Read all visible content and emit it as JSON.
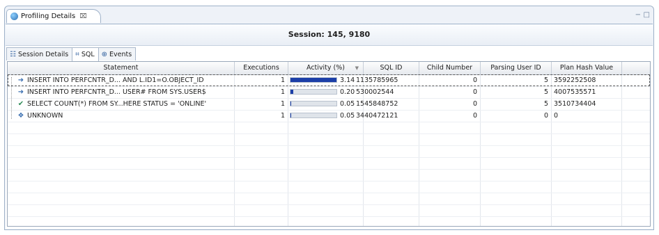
{
  "view": {
    "tab_label": "Profiling Details",
    "tab_close": "⌧",
    "minimize": "−",
    "maximize": "□"
  },
  "session": {
    "title": "Session: 145, 9180"
  },
  "subtabs": [
    {
      "label": "Session Details",
      "icon": "grid-icon",
      "glyph": "☷"
    },
    {
      "label": "SQL",
      "icon": "sql-icon",
      "glyph": "⌗"
    },
    {
      "label": "Events",
      "icon": "globe-icon",
      "glyph": "⊕"
    }
  ],
  "table": {
    "columns": [
      "Statement",
      "Executions",
      "Activity (%)",
      "SQL ID",
      "Child Number",
      "Parsing User ID",
      "Plan Hash Value"
    ],
    "sort_indicator": "▼",
    "rows": [
      {
        "statement": "INSERT INTO PERFCNTR_D... AND L.ID1=O.OBJECT_ID",
        "icon": "insert-icon",
        "glyph": "➜",
        "executions": "1",
        "activity": "3.14",
        "activity_fraction": 1.0,
        "sql_id": "1135785965",
        "child_number": "0",
        "parsing_user_id": "5",
        "plan_hash": "3592252508"
      },
      {
        "statement": "INSERT INTO PERFCNTR_D... USER# FROM SYS.USER$",
        "icon": "insert-icon",
        "glyph": "➜",
        "executions": "1",
        "activity": "0.20",
        "activity_fraction": 0.064,
        "sql_id": "530002544",
        "child_number": "0",
        "parsing_user_id": "5",
        "plan_hash": "4007535571"
      },
      {
        "statement": "SELECT COUNT(*) FROM SY...HERE STATUS = 'ONLINE'",
        "icon": "check-icon",
        "glyph": "✔",
        "executions": "1",
        "activity": "0.05",
        "activity_fraction": 0.016,
        "sql_id": "1545848752",
        "child_number": "0",
        "parsing_user_id": "5",
        "plan_hash": "3510734404"
      },
      {
        "statement": "UNKNOWN",
        "icon": "unknown-icon",
        "glyph": "❖",
        "executions": "1",
        "activity": "0.05",
        "activity_fraction": 0.016,
        "sql_id": "3440472121",
        "child_number": "0",
        "parsing_user_id": "0",
        "plan_hash": "0"
      }
    ]
  }
}
